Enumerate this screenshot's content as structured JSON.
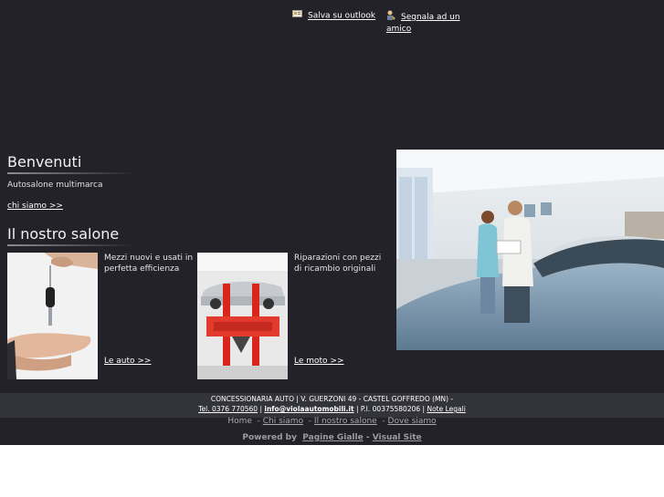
{
  "top_links": {
    "outlook": "Salva su outlook",
    "segnala": "Segnala ad un amico"
  },
  "welcome": {
    "title": "Benvenuti",
    "subtitle": "Autosalone multimarca",
    "link": "chi siamo >>"
  },
  "salone": {
    "title": "Il nostro salone",
    "item1_desc": "Mezzi nuovi e usati in perfetta efficienza",
    "item1_link": "Le auto >>",
    "item2_desc": "Riparazioni con pezzi di ricambio originali",
    "item2_link": "Le moto >>"
  },
  "footer": {
    "address": "CONCESSIONARIA AUTO | V. GUERZONI 49 - CASTEL GOFFREDO (MN) -",
    "tel": "Tel. 0376 770560",
    "sep1": " | ",
    "email": "info@violaautomobili.it",
    "piva": " | P.I. 00375580206 | ",
    "note": "Note Legali"
  },
  "nav": {
    "home": "Home",
    "items": [
      "Chi siamo",
      "Il nostro salone",
      "Dove siamo"
    ]
  },
  "powered": {
    "label": "Powered by",
    "link1": "Pagine Gialle",
    "sep": " - ",
    "link2": "Visual Site"
  },
  "icons": {
    "outlook": "outlook-card-icon",
    "segnala": "person-icon"
  },
  "colors": {
    "background": "#222228",
    "footer": "#33333a"
  }
}
